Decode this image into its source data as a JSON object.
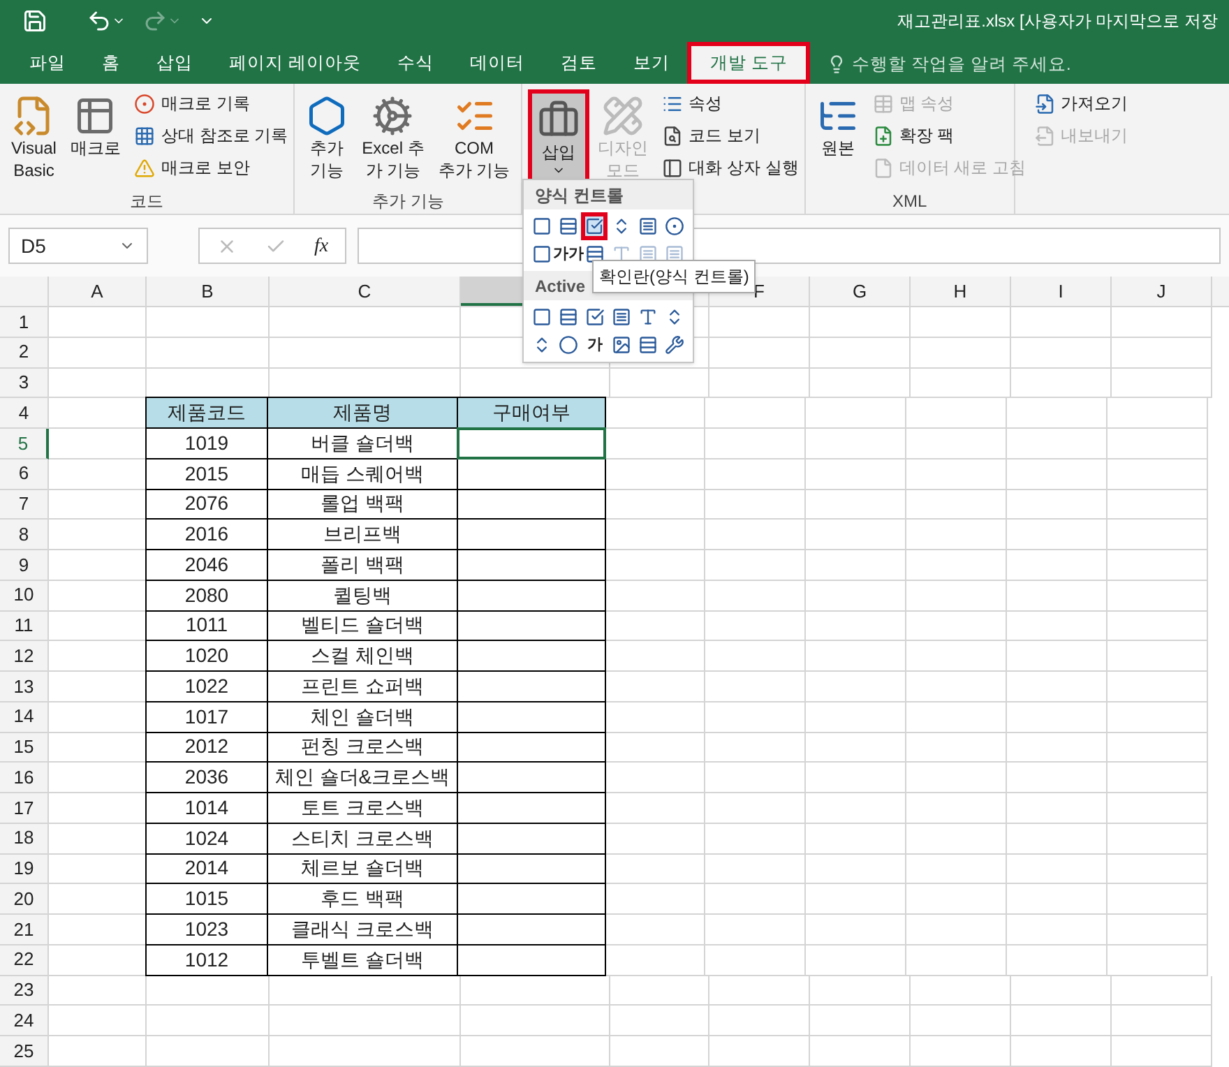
{
  "title_bar": {
    "title": "재고관리표.xlsx [사용자가 마지막으로 저장"
  },
  "tabs": [
    {
      "label": "파일",
      "selected": false,
      "highlighted": false
    },
    {
      "label": "홈",
      "selected": false,
      "highlighted": false
    },
    {
      "label": "삽입",
      "selected": false,
      "highlighted": false
    },
    {
      "label": "페이지 레이아웃",
      "selected": false,
      "highlighted": false
    },
    {
      "label": "수식",
      "selected": false,
      "highlighted": false
    },
    {
      "label": "데이터",
      "selected": false,
      "highlighted": false
    },
    {
      "label": "검토",
      "selected": false,
      "highlighted": false
    },
    {
      "label": "보기",
      "selected": false,
      "highlighted": false
    },
    {
      "label": "개발 도구",
      "selected": true,
      "highlighted": true
    }
  ],
  "tell_me": {
    "placeholder": "수행할 작업을 알려 주세요."
  },
  "ribbon": {
    "groups": [
      {
        "label": "코드",
        "large": [
          {
            "lines": [
              "Visual",
              "Basic"
            ],
            "disabled": false,
            "open": false,
            "highlighted": false,
            "kind": "plain"
          },
          {
            "lines": [
              "매크로"
            ],
            "disabled": false,
            "open": false,
            "highlighted": false,
            "kind": "plain"
          }
        ],
        "small_columns": [
          [
            {
              "label": "매크로 기록",
              "disabled": false
            },
            {
              "label": "상대 참조로 기록",
              "disabled": false
            },
            {
              "label": "매크로 보안",
              "disabled": false
            }
          ]
        ]
      },
      {
        "label": "추가 기능",
        "large": [
          {
            "lines": [
              "추가",
              "기능"
            ],
            "disabled": false,
            "open": false,
            "highlighted": false,
            "kind": "plain"
          },
          {
            "lines": [
              "Excel 추",
              "가 기능"
            ],
            "disabled": false,
            "open": false,
            "highlighted": false,
            "kind": "plain"
          },
          {
            "lines": [
              "COM",
              "추가 기능"
            ],
            "disabled": false,
            "open": false,
            "highlighted": false,
            "kind": "plain"
          }
        ]
      },
      {
        "large": [
          {
            "lines": [
              "삽입"
            ],
            "disabled": false,
            "open": true,
            "highlighted": true,
            "kind": "split"
          },
          {
            "lines": [
              "디자인",
              "모드"
            ],
            "disabled": true,
            "open": false,
            "highlighted": false,
            "kind": "plain"
          }
        ],
        "small_columns": [
          [
            {
              "label": "속성",
              "disabled": false
            },
            {
              "label": "코드 보기",
              "disabled": false
            },
            {
              "label": "대화 상자 실행",
              "disabled": false
            }
          ]
        ]
      },
      {
        "label": "XML",
        "large": [
          {
            "lines": [
              "원본"
            ],
            "disabled": false,
            "open": false,
            "highlighted": false,
            "kind": "plain"
          }
        ],
        "small_columns": [
          [
            {
              "label": "맵 속성",
              "disabled": true
            },
            {
              "label": "확장 팩",
              "disabled": false
            },
            {
              "label": "데이터 새로 고침",
              "disabled": true
            }
          ],
          [
            {
              "label": "가져오기",
              "disabled": false
            },
            {
              "label": "내보내기",
              "disabled": true
            }
          ]
        ]
      }
    ]
  },
  "insert_menu": {
    "sections": [
      {
        "title": "양식 컨트롤",
        "items": [
          {
            "disabled": false,
            "highlighted": false
          },
          {
            "disabled": false,
            "highlighted": false
          },
          {
            "disabled": false,
            "highlighted": true
          },
          {
            "disabled": false,
            "highlighted": false
          },
          {
            "disabled": false,
            "highlighted": false
          },
          {
            "disabled": false,
            "highlighted": false
          },
          {
            "disabled": false,
            "highlighted": false
          },
          {
            "disabled": false,
            "highlighted": false,
            "glyph": "가가"
          },
          {
            "disabled": false,
            "highlighted": false
          },
          {
            "disabled": true,
            "highlighted": false
          },
          {
            "disabled": true,
            "highlighted": false
          },
          {
            "disabled": true,
            "highlighted": false
          }
        ]
      },
      {
        "title": "Active",
        "items": [
          {
            "disabled": false,
            "highlighted": false
          },
          {
            "disabled": false,
            "highlighted": false
          },
          {
            "disabled": false,
            "highlighted": false
          },
          {
            "disabled": false,
            "highlighted": false
          },
          {
            "disabled": false,
            "highlighted": false
          },
          {
            "disabled": false,
            "highlighted": false
          },
          {
            "disabled": false,
            "highlighted": false
          },
          {
            "disabled": false,
            "highlighted": false
          },
          {
            "disabled": false,
            "highlighted": false,
            "glyph": "가"
          },
          {
            "disabled": false,
            "highlighted": false
          },
          {
            "disabled": false,
            "highlighted": false
          },
          {
            "disabled": false,
            "highlighted": false
          }
        ]
      }
    ]
  },
  "tooltip": "확인란(양식 컨트롤)",
  "formula_bar": {
    "name_box": "D5",
    "fx_label": "fx"
  },
  "sheet": {
    "columns": [
      {
        "label": "A",
        "selected": false
      },
      {
        "label": "B",
        "selected": false
      },
      {
        "label": "C",
        "selected": false
      },
      {
        "selected": true
      },
      {
        "selected": false
      },
      {
        "label": "F",
        "selected": false
      },
      {
        "label": "G",
        "selected": false
      },
      {
        "label": "H",
        "selected": false
      },
      {
        "label": "I",
        "selected": false
      },
      {
        "label": "J",
        "selected": false
      }
    ],
    "rows": [
      {
        "label": "1",
        "selected": false
      },
      {
        "label": "2",
        "selected": false
      },
      {
        "label": "3",
        "selected": false
      },
      {
        "label": "4",
        "selected": false
      },
      {
        "label": "5",
        "selected": true
      },
      {
        "label": "6",
        "selected": false
      },
      {
        "label": "7",
        "selected": false
      },
      {
        "label": "8",
        "selected": false
      },
      {
        "label": "9",
        "selected": false
      },
      {
        "label": "10",
        "selected": false
      },
      {
        "label": "11",
        "selected": false
      },
      {
        "label": "12",
        "selected": false
      },
      {
        "label": "13",
        "selected": false
      },
      {
        "label": "14",
        "selected": false
      },
      {
        "label": "15",
        "selected": false
      },
      {
        "label": "16",
        "selected": false
      },
      {
        "label": "17",
        "selected": false
      },
      {
        "label": "18",
        "selected": false
      },
      {
        "label": "19",
        "selected": false
      },
      {
        "label": "20",
        "selected": false
      },
      {
        "label": "21",
        "selected": false
      },
      {
        "label": "22",
        "selected": false
      },
      {
        "label": "23",
        "selected": false
      },
      {
        "label": "24",
        "selected": false
      },
      {
        "label": "25",
        "selected": false
      }
    ],
    "table": {
      "columns": [
        "제품코드",
        "제품명",
        "구매여부"
      ],
      "rows": [
        {
          "code": "1019",
          "name": "버클 숄더백",
          "selected": true
        },
        {
          "code": "2015",
          "name": "매듭 스퀘어백",
          "selected": false
        },
        {
          "code": "2076",
          "name": "롤업 백팩",
          "selected": false
        },
        {
          "code": "2016",
          "name": "브리프백",
          "selected": false
        },
        {
          "code": "2046",
          "name": "폴리 백팩",
          "selected": false
        },
        {
          "code": "2080",
          "name": "퀼팅백",
          "selected": false
        },
        {
          "code": "1011",
          "name": "벨티드 숄더백",
          "selected": false
        },
        {
          "code": "1020",
          "name": "스컬 체인백",
          "selected": false
        },
        {
          "code": "1022",
          "name": "프린트 쇼퍼백",
          "selected": false
        },
        {
          "code": "1017",
          "name": "체인 숄더백",
          "selected": false
        },
        {
          "code": "2012",
          "name": "펀칭 크로스백",
          "selected": false
        },
        {
          "code": "2036",
          "name": "체인 숄더&크로스백",
          "selected": false
        },
        {
          "code": "1014",
          "name": "토트 크로스백",
          "selected": false
        },
        {
          "code": "1024",
          "name": "스티치 크로스백",
          "selected": false
        },
        {
          "code": "2014",
          "name": "체르보 숄더백",
          "selected": false
        },
        {
          "code": "1015",
          "name": "후드 백팩",
          "selected": false
        },
        {
          "code": "1023",
          "name": "클래식 크로스백",
          "selected": false
        },
        {
          "code": "1012",
          "name": "투벨트 숄더백",
          "selected": false
        }
      ]
    }
  }
}
